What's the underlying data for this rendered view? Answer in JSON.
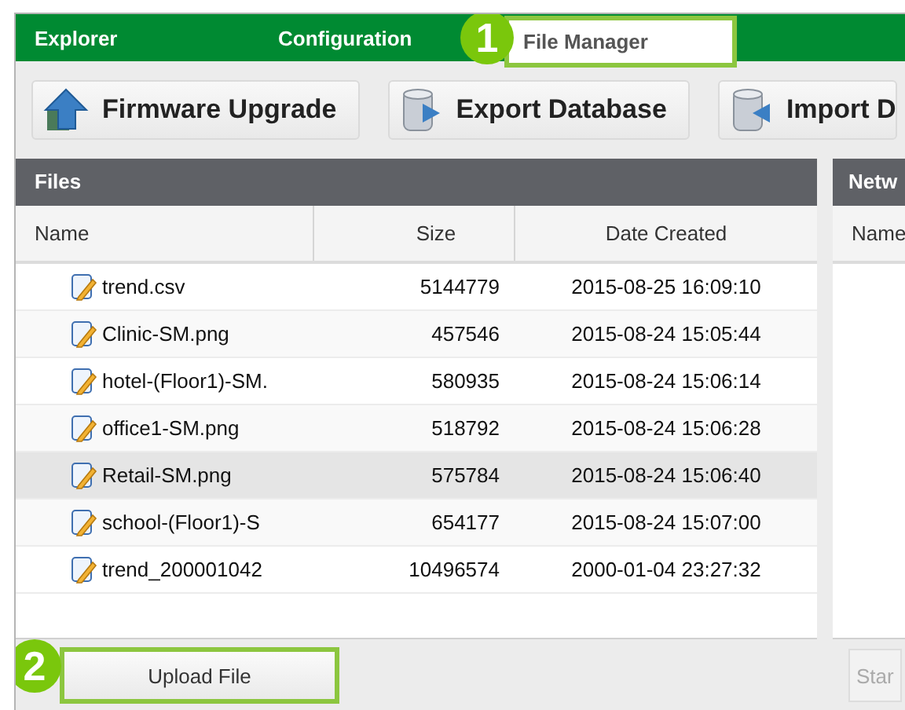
{
  "tabs": [
    {
      "label": "Explorer",
      "selected": false
    },
    {
      "label": "Configuration",
      "selected": false
    },
    {
      "label": "File Manager",
      "selected": true,
      "callout": "1"
    }
  ],
  "toolbar": [
    {
      "label": "Firmware Upgrade",
      "kind": "upload"
    },
    {
      "label": "Export Database",
      "kind": "export"
    },
    {
      "label": "Import D",
      "kind": "import"
    }
  ],
  "files_panel": {
    "title": "Files",
    "columns": [
      "Name",
      "Size",
      "Date Created"
    ],
    "rows": [
      {
        "name": "trend.csv",
        "size": "5144779",
        "date": "2015-08-25 16:09:10",
        "selected": false
      },
      {
        "name": "Clinic-SM.png",
        "size": "457546",
        "date": "2015-08-24 15:05:44",
        "selected": false
      },
      {
        "name": "hotel-(Floor1)-SM.",
        "size": "580935",
        "date": "2015-08-24 15:06:14",
        "selected": false
      },
      {
        "name": "office1-SM.png",
        "size": "518792",
        "date": "2015-08-24 15:06:28",
        "selected": false
      },
      {
        "name": "Retail-SM.png",
        "size": "575784",
        "date": "2015-08-24 15:06:40",
        "selected": true
      },
      {
        "name": "school-(Floor1)-S",
        "size": "654177",
        "date": "2015-08-24 15:07:00",
        "selected": false
      },
      {
        "name": "trend_200001042",
        "size": "10496574",
        "date": "2000-01-04 23:27:32",
        "selected": false
      }
    ],
    "button": {
      "label": "Upload File",
      "callout": "2"
    }
  },
  "network_panel": {
    "title": "Netw",
    "columns": [
      "Name"
    ],
    "button": "Star"
  }
}
